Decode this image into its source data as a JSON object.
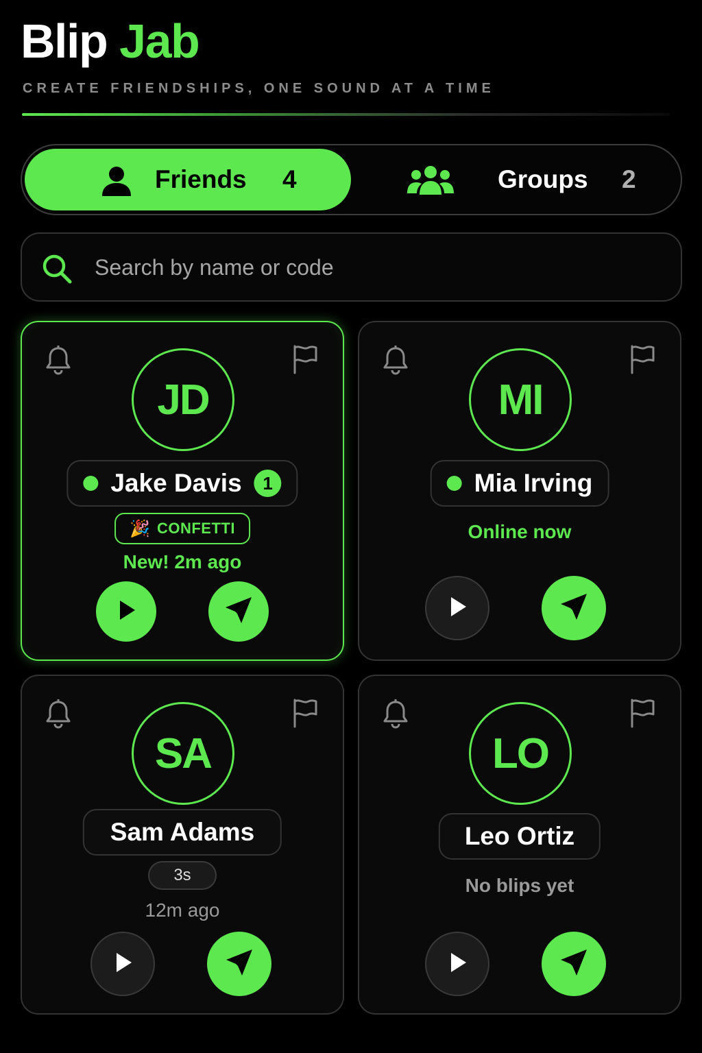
{
  "app": {
    "title_part1": "Blip",
    "title_part2": "Jab",
    "tagline": "CREATE FRIENDSHIPS, ONE SOUND AT A TIME"
  },
  "tabs": {
    "friends": {
      "label": "Friends",
      "count": "4",
      "icon": "user-icon"
    },
    "groups": {
      "label": "Groups",
      "count": "2",
      "icon": "users-group-icon"
    }
  },
  "search": {
    "placeholder": "Search by name or code",
    "value": "",
    "icon": "search-icon"
  },
  "friends": [
    {
      "initials": "JD",
      "name": "Jake Davis",
      "online": true,
      "unread": "1",
      "tag_label": "CONFETTI",
      "tag_emoji": "🎉",
      "status": "New! 2m ago",
      "active": true
    },
    {
      "initials": "MI",
      "name": "Mia Irving",
      "online": true,
      "status": "Online now"
    },
    {
      "initials": "SA",
      "name": "Sam Adams",
      "online": false,
      "duration": "3s",
      "status": "12m ago"
    },
    {
      "initials": "LO",
      "name": "Leo Ortiz",
      "online": false,
      "status": "No blips yet"
    }
  ],
  "colors": {
    "accent": "#5de84f",
    "background": "#000000",
    "border": "#333333",
    "muted": "#9a9a9a"
  },
  "icons": {
    "bell": "bell-icon",
    "flag": "flag-icon",
    "play": "play-icon",
    "send": "send-icon"
  }
}
